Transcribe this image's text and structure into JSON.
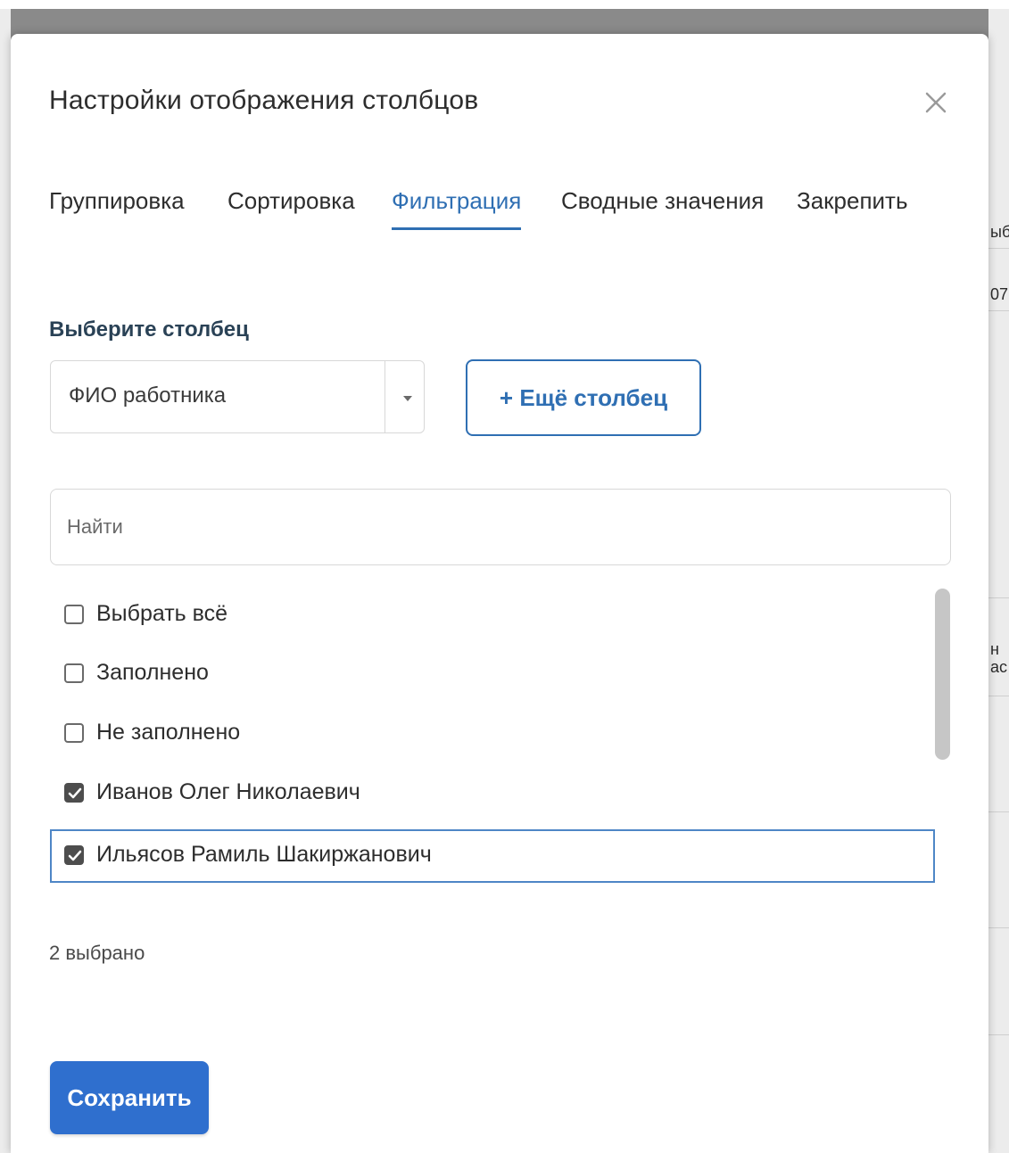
{
  "dialog": {
    "title": "Настройки отображения столбцов"
  },
  "tabs": [
    {
      "label": "Группировка",
      "active": false
    },
    {
      "label": "Сортировка",
      "active": false
    },
    {
      "label": "Фильтрация",
      "active": true
    },
    {
      "label": "Сводные значения",
      "active": false
    },
    {
      "label": "Закрепить",
      "active": false
    }
  ],
  "column_select": {
    "label": "Выберите столбец",
    "value": "ФИО работника"
  },
  "add_column_button": "+ Ещё столбец",
  "search": {
    "placeholder": "Найти",
    "value": ""
  },
  "filter_items": [
    {
      "label": "Выбрать всё",
      "checked": false
    },
    {
      "label": "Заполнено",
      "checked": false
    },
    {
      "label": "Не заполнено",
      "checked": false
    },
    {
      "label": "Иванов Олег Николаевич",
      "checked": true
    },
    {
      "label": "Ильясов Рамиль Шакиржанович",
      "checked": true,
      "focused": true
    }
  ],
  "selected_count": "2 выбрано",
  "save_button": "Сохранить",
  "background_fragments": {
    "right_top": "ыб",
    "right_row": "07",
    "right_mid_1": "н",
    "right_mid_2": "ас"
  },
  "colors": {
    "accent": "#2f6fb3",
    "save_button": "#2f6fce",
    "section_label": "#2a4256"
  }
}
